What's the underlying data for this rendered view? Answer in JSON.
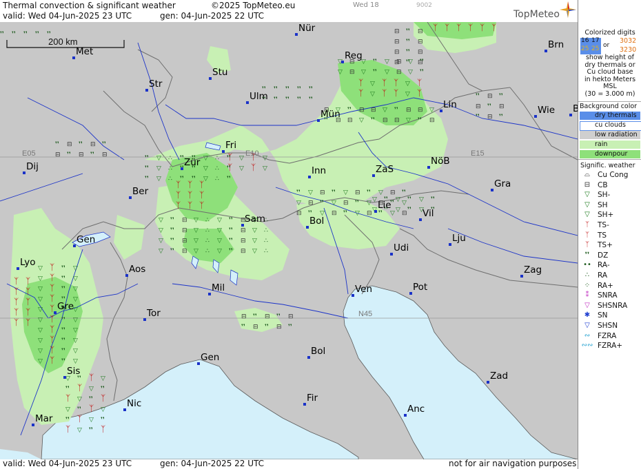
{
  "header": {
    "title": "Thermal convection & significant weather",
    "copyright": "©2025 TopMeteo.eu",
    "day_label": "Wed 18",
    "code": "9002",
    "valid_line": "valid:  Wed  04-Jun-2025  23 UTC",
    "gen_line": "gen: 04-Jun-2025 22 UTC",
    "brand": "TopMeteo"
  },
  "footer": {
    "valid_line": "valid:  Wed  04-Jun-2025  23 UTC",
    "gen_line": "gen: 04-Jun-2025 22 UTC",
    "note": "not for air navigation purposes"
  },
  "scale": {
    "label": "200 km"
  },
  "grid_labels": [
    "E05",
    "E10",
    "E15",
    "N45"
  ],
  "cities": [
    "Nür",
    "Reg",
    "Brn",
    "Met",
    "Stu",
    "Str",
    "Ulm",
    "Mün",
    "Lin",
    "Wie",
    "B",
    "Fri",
    "Dij",
    "Zür",
    "Inn",
    "ZaS",
    "NöB",
    "Gra",
    "Ber",
    "Lie",
    "Vil",
    "Sam",
    "Bol",
    "Lju",
    "Gen",
    "Udi",
    "Lyo",
    "Aos",
    "Zag",
    "Mil",
    "Ven",
    "Pot",
    "Gre",
    "Tor",
    "N45",
    "Bol",
    "Gen",
    "Zad",
    "Sis",
    "Nic",
    "Fir",
    "Anc",
    "Mar"
  ],
  "legend": {
    "digits_title": "Colorized digits",
    "digits_sample": [
      "16",
      "17",
      "3032",
      "25",
      "25",
      "3230"
    ],
    "digits_or": "or",
    "digits_desc": [
      "show height of",
      "dry thermals or",
      "Cu cloud base",
      "in hekto Meters",
      "MSL",
      "(30 = 3.000 m)"
    ],
    "bg_title": "Background color",
    "bg_items": [
      {
        "label": "dry thermals",
        "color": "#5a8ee8"
      },
      {
        "label": "cu clouds",
        "color": "#ffffff"
      },
      {
        "label": "low radiation",
        "color": "#cfcfcf"
      },
      {
        "label": "rain",
        "color": "#c8f0b4"
      },
      {
        "label": "downpour",
        "color": "#8ee07a"
      }
    ],
    "wx_title": "Signific. weather",
    "wx_items": [
      {
        "label": "Cu Cong",
        "icon": "cu-cong-icon",
        "color": "#333333",
        "glyph": "⌓"
      },
      {
        "label": "CB",
        "icon": "cb-icon",
        "color": "#333333",
        "glyph": "⊟"
      },
      {
        "label": "SH-",
        "icon": "shower-light-icon",
        "color": "#1d7a1d",
        "glyph": "▽"
      },
      {
        "label": "SH",
        "icon": "shower-icon",
        "color": "#1d7a1d",
        "glyph": "▽"
      },
      {
        "label": "SH+",
        "icon": "shower-heavy-icon",
        "color": "#1d7a1d",
        "glyph": "▽"
      },
      {
        "label": "TS-",
        "icon": "thunderstorm-light-icon",
        "color": "#c01010",
        "glyph": "ᛉ"
      },
      {
        "label": "TS",
        "icon": "thunderstorm-icon",
        "color": "#c01010",
        "glyph": "ᛉ"
      },
      {
        "label": "TS+",
        "icon": "thunderstorm-heavy-icon",
        "color": "#c01010",
        "glyph": "ᛉ"
      },
      {
        "label": "DZ",
        "icon": "drizzle-icon",
        "color": "#1d5a1d",
        "glyph": "❜❜"
      },
      {
        "label": "RA-",
        "icon": "rain-light-icon",
        "color": "#1d5a1d",
        "glyph": "••"
      },
      {
        "label": "RA",
        "icon": "rain-icon",
        "color": "#1d5a1d",
        "glyph": "∴"
      },
      {
        "label": "RA+",
        "icon": "rain-heavy-icon",
        "color": "#1d5a1d",
        "glyph": "⁘"
      },
      {
        "label": "SNRA",
        "icon": "snow-rain-icon",
        "color": "#c030c0",
        "glyph": "⁑"
      },
      {
        "label": "SHSNRA",
        "icon": "snow-rain-shower-icon",
        "color": "#c030c0",
        "glyph": "▽"
      },
      {
        "label": "SN",
        "icon": "snow-icon",
        "color": "#2040d0",
        "glyph": "✱"
      },
      {
        "label": "SHSN",
        "icon": "snow-shower-icon",
        "color": "#2040d0",
        "glyph": "▽"
      },
      {
        "label": "FZRA",
        "icon": "freezing-rain-icon",
        "color": "#20a0d0",
        "glyph": "∾"
      },
      {
        "label": "FZRA+",
        "icon": "freezing-rain-heavy-icon",
        "color": "#20a0d0",
        "glyph": "∾∾"
      }
    ]
  },
  "colors": {
    "land": "#c8c8c8",
    "sea": "#d4f0fa",
    "rain": "#c8f0b4",
    "downpour": "#8ee07a",
    "rivers": "#1a32c8",
    "borders": "#6e6e6e"
  }
}
